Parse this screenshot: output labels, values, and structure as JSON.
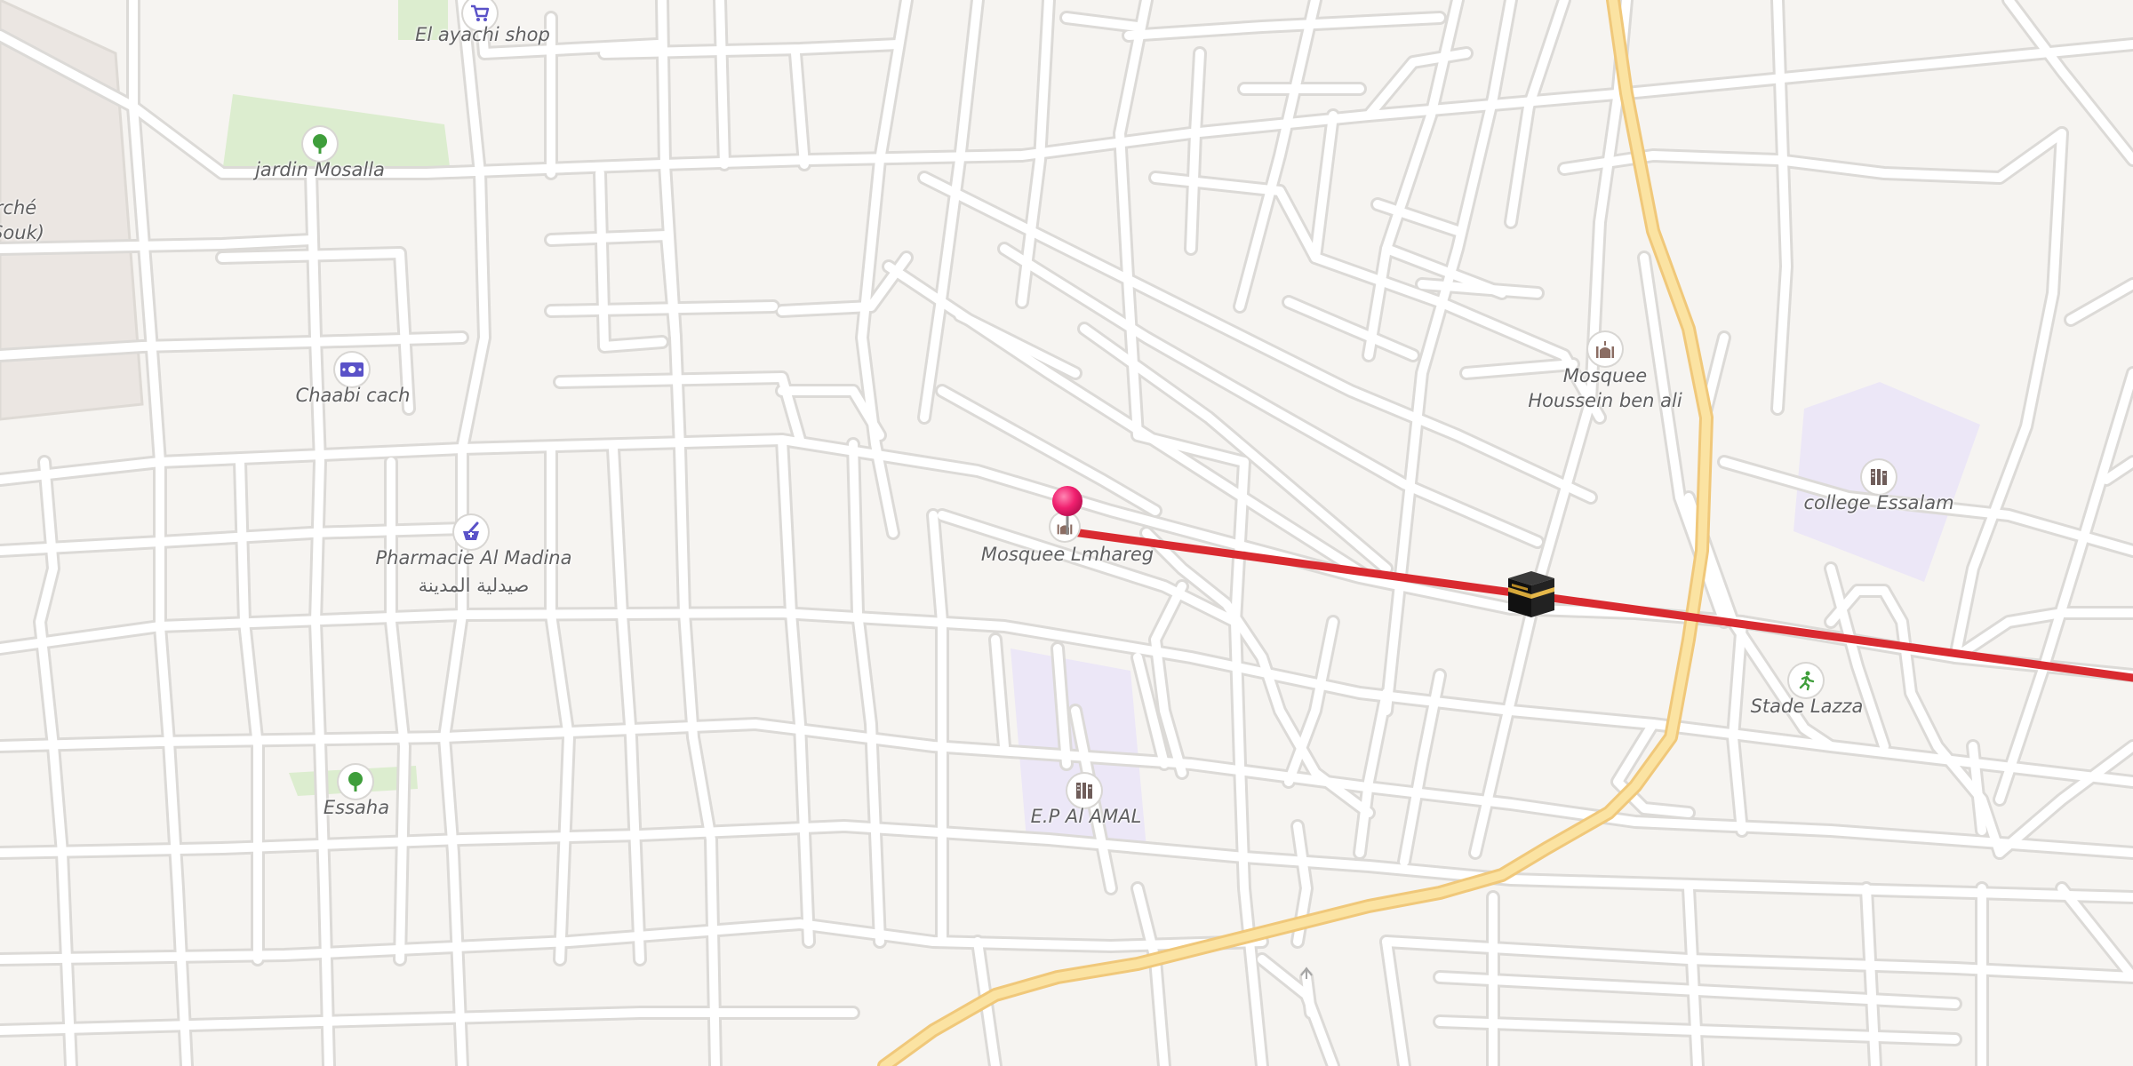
{
  "map": {
    "colors": {
      "land": "#f6f4f1",
      "road_fill": "#ffffff",
      "road_casing": "#dcdad7",
      "main_road_fill": "#fbe3a2",
      "main_road_casing": "#f0c87a",
      "park": "#dcedcf",
      "school": "#ece7f7",
      "market": "#ebe6e2",
      "route_line": "#d92a30",
      "pin": "#f0206f"
    },
    "labels": {
      "el_ayachi_shop": "El ayachi shop",
      "jardin_mosalla": "jardin Mosalla",
      "marche_line1": "rché",
      "marche_line2": "Souk)",
      "chaabi_cach": "Chaabi cach",
      "pharmacie_fr": "Pharmacie Al Madina",
      "pharmacie_ar": "صيدلية المدينة",
      "essaha": "Essaha",
      "mosquee_lmhareg": "Mosquee Lmhareg",
      "mosquee_houssein_1": "Mosquee",
      "mosquee_houssein_2": "Houssein ben ali",
      "college_essalam": "college Essalam",
      "stade_lazza": "Stade Lazza",
      "ep_al_amal": "E.P Al AMAL"
    },
    "icons": {
      "shop": "shopping-cart-icon",
      "park": "tree-icon",
      "bank": "banknote-icon",
      "pharmacy": "mortar-pestle-icon",
      "mosque": "mosque-icon",
      "school": "school-icon",
      "stadium": "running-figure-icon",
      "qibla": "kaaba-icon",
      "pin": "map-pin-icon"
    }
  }
}
